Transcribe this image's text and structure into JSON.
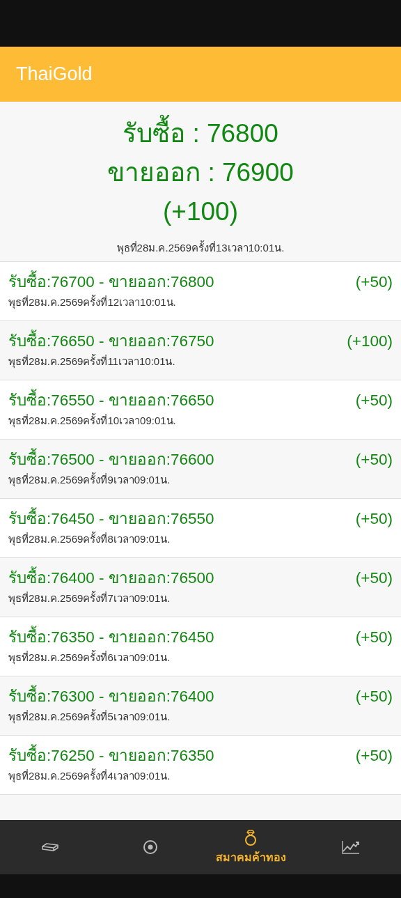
{
  "app_bar": {
    "title": "ThaiGold"
  },
  "latest": {
    "buy": "รับซื้อ : 76800",
    "sell": "ขายออก : 76900",
    "change": "(+100)",
    "timestamp": "พุธที่28ม.ค.2569ครั้งที่13เวลา10:01น."
  },
  "history": [
    {
      "prices": "รับซื้อ:76700 - ขายออก:76800",
      "change": "(+50)",
      "timestamp": "พุธที่28ม.ค.2569ครั้งที่12เวลา10:01น."
    },
    {
      "prices": "รับซื้อ:76650 - ขายออก:76750",
      "change": "(+100)",
      "timestamp": "พุธที่28ม.ค.2569ครั้งที่11เวลา10:01น."
    },
    {
      "prices": "รับซื้อ:76550 - ขายออก:76650",
      "change": "(+50)",
      "timestamp": "พุธที่28ม.ค.2569ครั้งที่10เวลา09:01น."
    },
    {
      "prices": "รับซื้อ:76500 - ขายออก:76600",
      "change": "(+50)",
      "timestamp": "พุธที่28ม.ค.2569ครั้งที่9เวลา09:01น."
    },
    {
      "prices": "รับซื้อ:76450 - ขายออก:76550",
      "change": "(+50)",
      "timestamp": "พุธที่28ม.ค.2569ครั้งที่8เวลา09:01น."
    },
    {
      "prices": "รับซื้อ:76400 - ขายออก:76500",
      "change": "(+50)",
      "timestamp": "พุธที่28ม.ค.2569ครั้งที่7เวลา09:01น."
    },
    {
      "prices": "รับซื้อ:76350 - ขายออก:76450",
      "change": "(+50)",
      "timestamp": "พุธที่28ม.ค.2569ครั้งที่6เวลา09:01น."
    },
    {
      "prices": "รับซื้อ:76300 - ขายออก:76400",
      "change": "(+50)",
      "timestamp": "พุธที่28ม.ค.2569ครั้งที่5เวลา09:01น."
    },
    {
      "prices": "รับซื้อ:76250 - ขายออก:76350",
      "change": "(+50)",
      "timestamp": "พุธที่28ม.ค.2569ครั้งที่4เวลา09:01น."
    }
  ],
  "bottom_nav": [
    {
      "kind": "bar",
      "selected": false
    },
    {
      "kind": "coin",
      "selected": false
    },
    {
      "kind": "ring",
      "selected": true,
      "label": "สมาคมค้าทอง"
    },
    {
      "kind": "chart",
      "selected": false
    }
  ]
}
